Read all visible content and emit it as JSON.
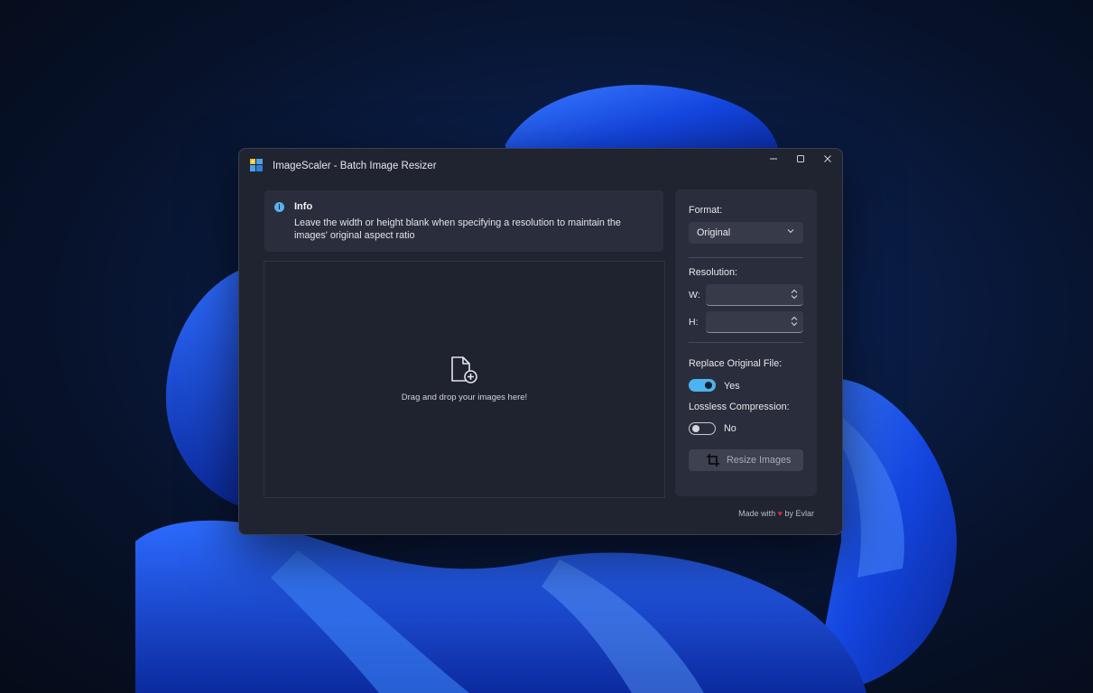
{
  "window": {
    "title": "ImageScaler - Batch Image Resizer"
  },
  "info": {
    "title": "Info",
    "message": "Leave the width or height blank when specifying a resolution to maintain the images' original aspect ratio"
  },
  "dropzone": {
    "text": "Drag and drop your images here!"
  },
  "settings": {
    "format_label": "Format:",
    "format_value": "Original",
    "resolution_label": "Resolution:",
    "width_label": "W:",
    "height_label": "H:",
    "width_value": "",
    "height_value": "",
    "replace_label": "Replace Original File:",
    "replace_value": "Yes",
    "lossless_label": "Lossless Compression:",
    "lossless_value": "No",
    "resize_button": "Resize Images"
  },
  "footer": {
    "made_with": "Made with",
    "by": "by Evlar"
  },
  "icons": {
    "app": "app-grid-icon",
    "info": "info-icon",
    "drop": "file-add-icon",
    "crop": "crop-icon"
  },
  "colors": {
    "accent": "#4cb4f0",
    "heart": "#d6293a",
    "window_bg": "#202431"
  }
}
